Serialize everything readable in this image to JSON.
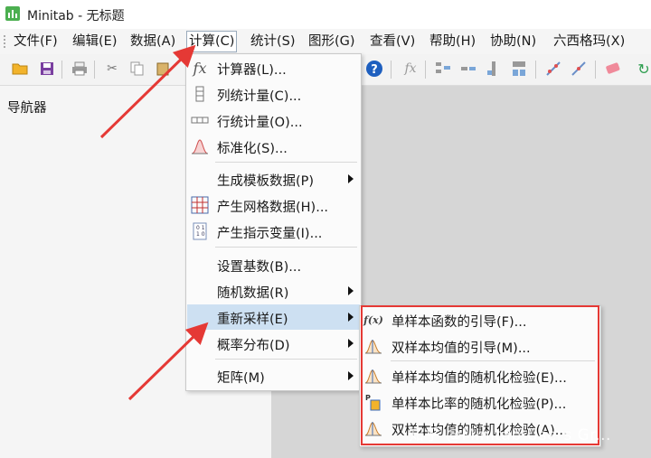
{
  "window": {
    "title": "Minitab - 无标题"
  },
  "menubar": {
    "items": [
      {
        "label": "文件(F)"
      },
      {
        "label": "编辑(E)"
      },
      {
        "label": "数据(A)"
      },
      {
        "label": "计算(C)"
      },
      {
        "label": "统计(S)"
      },
      {
        "label": "图形(G)"
      },
      {
        "label": "查看(V)"
      },
      {
        "label": "帮助(H)"
      },
      {
        "label": "协助(N)"
      },
      {
        "label": "六西格玛(X)"
      }
    ],
    "active": "计算(C)"
  },
  "navigator": {
    "title": "导航器"
  },
  "calc_menu": {
    "items": [
      {
        "label": "计算器(L)...",
        "icon": "fx-icon"
      },
      {
        "label": "列统计量(C)...",
        "icon": "column-icon"
      },
      {
        "label": "行统计量(O)...",
        "icon": "row-icon"
      },
      {
        "label": "标准化(S)...",
        "icon": "bell-curve-icon"
      },
      {
        "label": "生成模板数据(P)",
        "icon": "none",
        "submenu": true
      },
      {
        "label": "产生网格数据(H)...",
        "icon": "grid-icon"
      },
      {
        "label": "产生指示变量(I)...",
        "icon": "indicator-icon"
      },
      {
        "label": "设置基数(B)...",
        "icon": "none"
      },
      {
        "label": "随机数据(R)",
        "icon": "none",
        "submenu": true
      },
      {
        "label": "重新采样(E)",
        "icon": "none",
        "submenu": true,
        "highlighted": true
      },
      {
        "label": "概率分布(D)",
        "icon": "none",
        "submenu": true
      },
      {
        "label": "矩阵(M)",
        "icon": "none",
        "submenu": true
      }
    ]
  },
  "resample_menu": {
    "items": [
      {
        "label": "单样本函数的引导(F)...",
        "icon": "fx-small-icon"
      },
      {
        "label": "双样本均值的引导(M)...",
        "icon": "distribution-icon"
      },
      {
        "label": "单样本均值的随机化检验(E)...",
        "icon": "distribution-icon"
      },
      {
        "label": "单样本比率的随机化检验(P)...",
        "icon": "proportion-icon"
      },
      {
        "label": "双样本均值的随机化检验(A)...",
        "icon": "distribution-icon"
      }
    ]
  },
  "watermark": "知乎 @Minitab Users Gr...",
  "colors": {
    "highlight": "#cde0f2",
    "annotation": "#e53935",
    "app_green": "#4caf50"
  }
}
